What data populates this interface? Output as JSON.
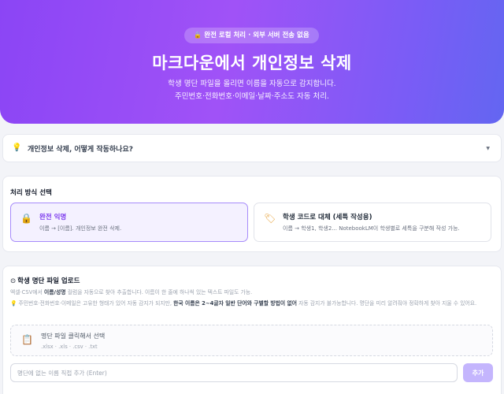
{
  "hero": {
    "badge": "완전 로컬 처리 · 외부 서버 전송 없음",
    "title": "마크다운에서 개인정보 삭제",
    "desc_line1": "학생 명단 파일을 올리면 이름을 자동으로 감지합니다.",
    "desc_line2": "주민번호·전화번호·이메일·날짜·주소도 자동 처리."
  },
  "faq": {
    "question": "개인정보 삭제, 어떻게 작동하나요?"
  },
  "mode": {
    "title": "처리 방식 선택",
    "options": [
      {
        "label": "완전 익명",
        "desc": "이름 → [이름]. 개인정보 완전 삭제.",
        "selected": true,
        "icon": "lock-icon"
      },
      {
        "label": "학생 코드로 대체 (세특 작성용)",
        "desc": "이름 → 학생1, 학생2... NotebookLM이 학생별로 세특을 구분해 작성 가능.",
        "selected": false,
        "icon": "tag-icon"
      }
    ]
  },
  "upload": {
    "title": "학생 명단 파일 업로드",
    "info1_pre": "엑셀·CSV에서 ",
    "info1_bold": "이름/성명",
    "info1_post": " 컬럼을 자동으로 찾아 추출합니다. 이름이 한 줄에 하나씩 있는 텍스트 파일도 가능.",
    "info2_pre": "주민번호·전화번호·이메일은 고유한 형태가 있어 자동 감지가 되지만, ",
    "info2_bold": "한국 이름은 2~4글자 일반 단어와 구별할 방법이 없어",
    "info2_post": " 자동 감지가 불가능합니다. 명단을 미리 알려줘야 정확하게 찾아 지울 수 있어요.",
    "drop_label": "명단 파일 클릭해서 선택",
    "drop_formats": ".xlsx · .xls · .csv · .txt",
    "input_placeholder": "명단에 없는 이름 직접 추가 (Enter)",
    "input_value": "",
    "add_label": "추가"
  },
  "colors": {
    "accent": "#8b45f5",
    "selected_border": "#a78bfa",
    "button": "#c4b5fd"
  }
}
